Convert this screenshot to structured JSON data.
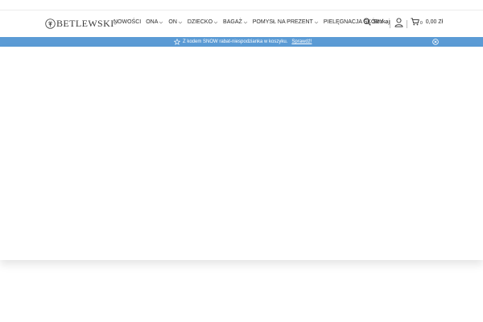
{
  "brand": {
    "logo_text": "BETLEWSKI",
    "logo_mark": "®"
  },
  "nav": {
    "items": [
      {
        "label": "NOWOŚCI",
        "has_dropdown": false
      },
      {
        "label": "ONA",
        "has_dropdown": true
      },
      {
        "label": "ON",
        "has_dropdown": true
      },
      {
        "label": "DZIECKO",
        "has_dropdown": true
      },
      {
        "label": "BAGAŻ",
        "has_dropdown": true
      },
      {
        "label": "POMYSŁ NA PREZENT",
        "has_dropdown": true
      },
      {
        "label": "PIELĘGNACJA SKÓRY",
        "has_dropdown": true
      }
    ]
  },
  "header": {
    "search_label": "Szukaj",
    "search_icon": "search-icon",
    "user_icon": "user-icon",
    "cart_icon": "cart-icon",
    "cart_count": "0",
    "cart_total": "0,00 Zł"
  },
  "banner": {
    "text": "Z kodem SNOW rabat-niespodzianka w koszyku.",
    "link": "Sprawdź!",
    "icon": "star-icon",
    "close_icon": "close-icon",
    "background": "#5b9bd5"
  }
}
